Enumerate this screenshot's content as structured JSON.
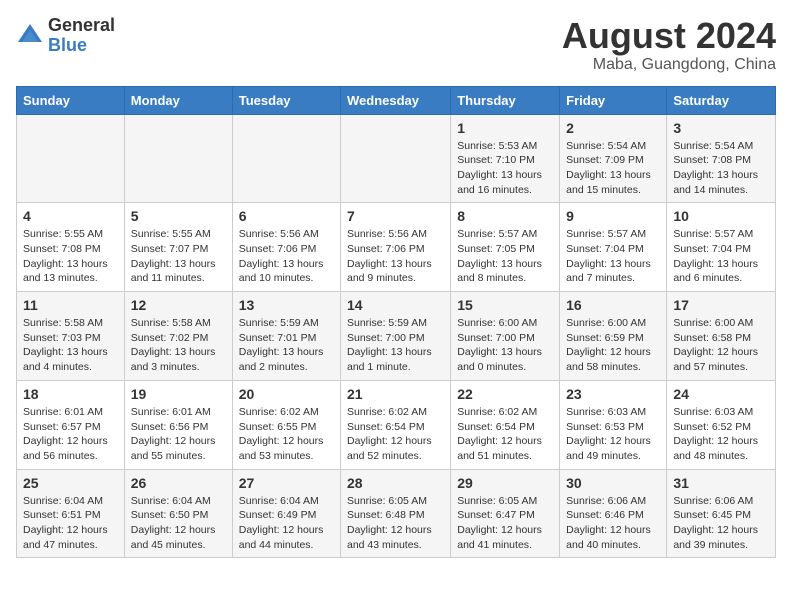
{
  "logo": {
    "general": "General",
    "blue": "Blue"
  },
  "header": {
    "month_year": "August 2024",
    "location": "Maba, Guangdong, China"
  },
  "weekdays": [
    "Sunday",
    "Monday",
    "Tuesday",
    "Wednesday",
    "Thursday",
    "Friday",
    "Saturday"
  ],
  "weeks": [
    [
      {
        "day": "",
        "info": ""
      },
      {
        "day": "",
        "info": ""
      },
      {
        "day": "",
        "info": ""
      },
      {
        "day": "",
        "info": ""
      },
      {
        "day": "1",
        "info": "Sunrise: 5:53 AM\nSunset: 7:10 PM\nDaylight: 13 hours\nand 16 minutes."
      },
      {
        "day": "2",
        "info": "Sunrise: 5:54 AM\nSunset: 7:09 PM\nDaylight: 13 hours\nand 15 minutes."
      },
      {
        "day": "3",
        "info": "Sunrise: 5:54 AM\nSunset: 7:08 PM\nDaylight: 13 hours\nand 14 minutes."
      }
    ],
    [
      {
        "day": "4",
        "info": "Sunrise: 5:55 AM\nSunset: 7:08 PM\nDaylight: 13 hours\nand 13 minutes."
      },
      {
        "day": "5",
        "info": "Sunrise: 5:55 AM\nSunset: 7:07 PM\nDaylight: 13 hours\nand 11 minutes."
      },
      {
        "day": "6",
        "info": "Sunrise: 5:56 AM\nSunset: 7:06 PM\nDaylight: 13 hours\nand 10 minutes."
      },
      {
        "day": "7",
        "info": "Sunrise: 5:56 AM\nSunset: 7:06 PM\nDaylight: 13 hours\nand 9 minutes."
      },
      {
        "day": "8",
        "info": "Sunrise: 5:57 AM\nSunset: 7:05 PM\nDaylight: 13 hours\nand 8 minutes."
      },
      {
        "day": "9",
        "info": "Sunrise: 5:57 AM\nSunset: 7:04 PM\nDaylight: 13 hours\nand 7 minutes."
      },
      {
        "day": "10",
        "info": "Sunrise: 5:57 AM\nSunset: 7:04 PM\nDaylight: 13 hours\nand 6 minutes."
      }
    ],
    [
      {
        "day": "11",
        "info": "Sunrise: 5:58 AM\nSunset: 7:03 PM\nDaylight: 13 hours\nand 4 minutes."
      },
      {
        "day": "12",
        "info": "Sunrise: 5:58 AM\nSunset: 7:02 PM\nDaylight: 13 hours\nand 3 minutes."
      },
      {
        "day": "13",
        "info": "Sunrise: 5:59 AM\nSunset: 7:01 PM\nDaylight: 13 hours\nand 2 minutes."
      },
      {
        "day": "14",
        "info": "Sunrise: 5:59 AM\nSunset: 7:00 PM\nDaylight: 13 hours\nand 1 minute."
      },
      {
        "day": "15",
        "info": "Sunrise: 6:00 AM\nSunset: 7:00 PM\nDaylight: 13 hours\nand 0 minutes."
      },
      {
        "day": "16",
        "info": "Sunrise: 6:00 AM\nSunset: 6:59 PM\nDaylight: 12 hours\nand 58 minutes."
      },
      {
        "day": "17",
        "info": "Sunrise: 6:00 AM\nSunset: 6:58 PM\nDaylight: 12 hours\nand 57 minutes."
      }
    ],
    [
      {
        "day": "18",
        "info": "Sunrise: 6:01 AM\nSunset: 6:57 PM\nDaylight: 12 hours\nand 56 minutes."
      },
      {
        "day": "19",
        "info": "Sunrise: 6:01 AM\nSunset: 6:56 PM\nDaylight: 12 hours\nand 55 minutes."
      },
      {
        "day": "20",
        "info": "Sunrise: 6:02 AM\nSunset: 6:55 PM\nDaylight: 12 hours\nand 53 minutes."
      },
      {
        "day": "21",
        "info": "Sunrise: 6:02 AM\nSunset: 6:54 PM\nDaylight: 12 hours\nand 52 minutes."
      },
      {
        "day": "22",
        "info": "Sunrise: 6:02 AM\nSunset: 6:54 PM\nDaylight: 12 hours\nand 51 minutes."
      },
      {
        "day": "23",
        "info": "Sunrise: 6:03 AM\nSunset: 6:53 PM\nDaylight: 12 hours\nand 49 minutes."
      },
      {
        "day": "24",
        "info": "Sunrise: 6:03 AM\nSunset: 6:52 PM\nDaylight: 12 hours\nand 48 minutes."
      }
    ],
    [
      {
        "day": "25",
        "info": "Sunrise: 6:04 AM\nSunset: 6:51 PM\nDaylight: 12 hours\nand 47 minutes."
      },
      {
        "day": "26",
        "info": "Sunrise: 6:04 AM\nSunset: 6:50 PM\nDaylight: 12 hours\nand 45 minutes."
      },
      {
        "day": "27",
        "info": "Sunrise: 6:04 AM\nSunset: 6:49 PM\nDaylight: 12 hours\nand 44 minutes."
      },
      {
        "day": "28",
        "info": "Sunrise: 6:05 AM\nSunset: 6:48 PM\nDaylight: 12 hours\nand 43 minutes."
      },
      {
        "day": "29",
        "info": "Sunrise: 6:05 AM\nSunset: 6:47 PM\nDaylight: 12 hours\nand 41 minutes."
      },
      {
        "day": "30",
        "info": "Sunrise: 6:06 AM\nSunset: 6:46 PM\nDaylight: 12 hours\nand 40 minutes."
      },
      {
        "day": "31",
        "info": "Sunrise: 6:06 AM\nSunset: 6:45 PM\nDaylight: 12 hours\nand 39 minutes."
      }
    ]
  ]
}
